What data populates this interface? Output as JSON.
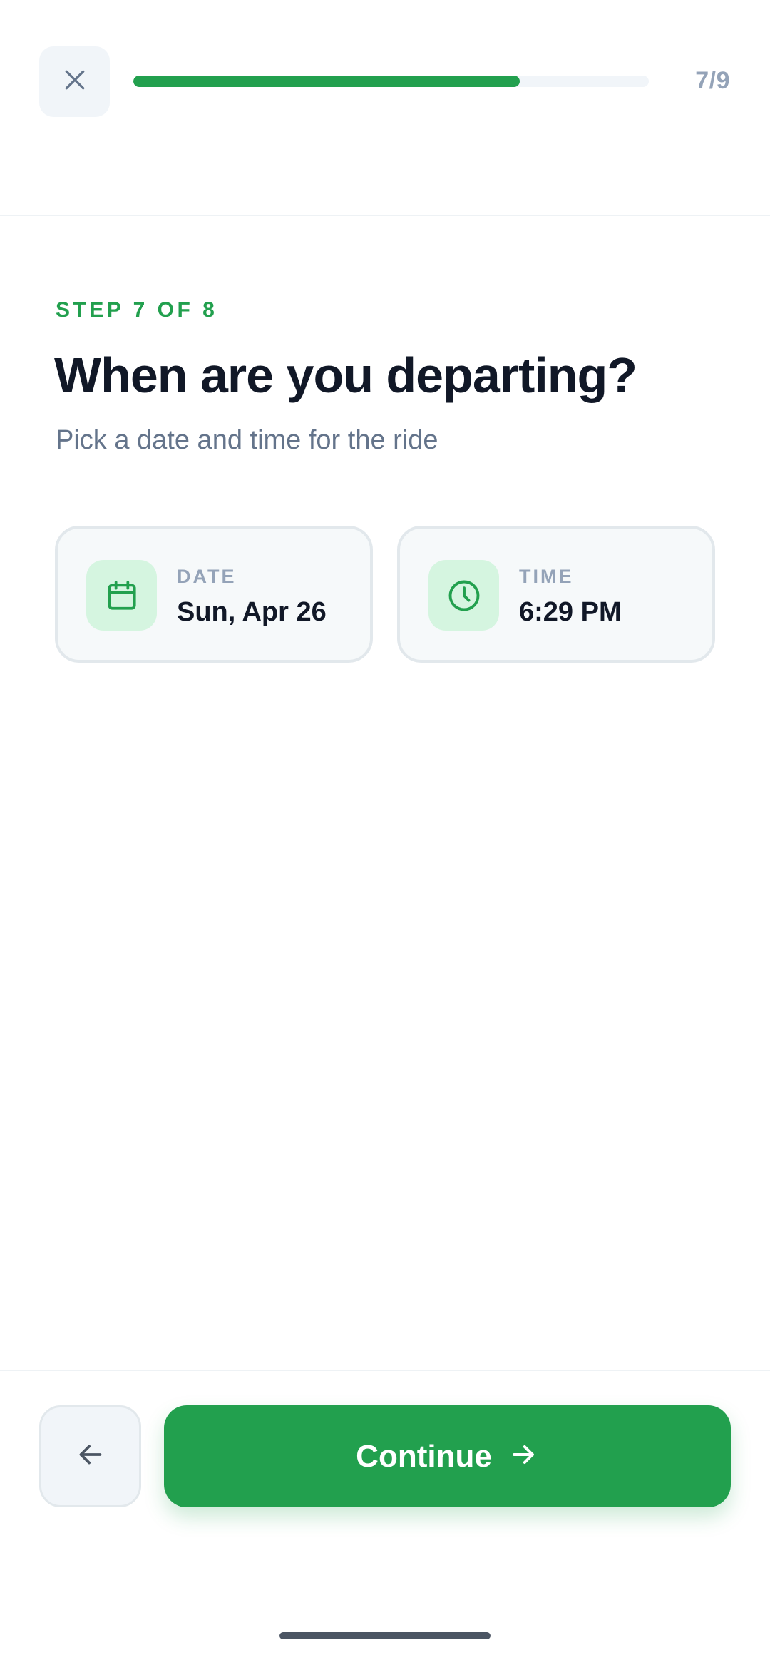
{
  "header": {
    "progress_count": "7/9",
    "progress_fraction": 0.75
  },
  "step": {
    "eyebrow": "STEP 7 OF 8",
    "title": "When are you departing?",
    "subtitle": "Pick a date and time for the ride"
  },
  "date_card": {
    "label": "DATE",
    "value": "Sun, Apr 26",
    "icon": "calendar-icon"
  },
  "time_card": {
    "label": "TIME",
    "value": "6:29 PM",
    "icon": "clock-icon"
  },
  "footer": {
    "continue_label": "Continue"
  },
  "colors": {
    "accent": "#22A04E",
    "accent_light": "#D5F5E0",
    "title": "#111827",
    "muted": "#64748B"
  }
}
